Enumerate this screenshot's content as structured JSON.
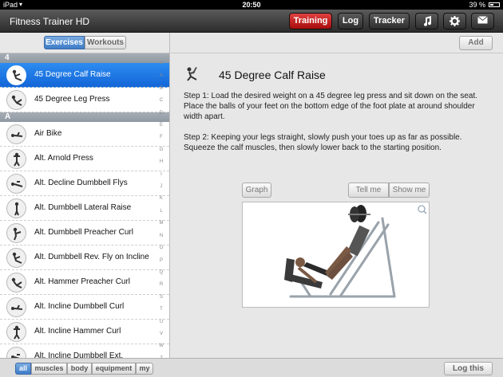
{
  "status": {
    "device": "iPad",
    "time": "20:50",
    "battery": "39 %"
  },
  "nav": {
    "app_title": "Fitness Trainer HD",
    "training": "Training",
    "log": "Log",
    "tracker": "Tracker",
    "music_icon": "music-note-icon",
    "settings_icon": "gear-icon",
    "mail_icon": "envelope-icon"
  },
  "left": {
    "tab_exercises": "Exercises",
    "tab_workouts": "Workouts",
    "section_4": "4",
    "section_a": "A",
    "index": [
      "4",
      "A",
      "B",
      "C",
      "D",
      "E",
      "F",
      "G",
      "H",
      "I",
      "J",
      "K",
      "L",
      "M",
      "N",
      "O",
      "P",
      "Q",
      "R",
      "S",
      "T",
      "U",
      "V",
      "W",
      "Z"
    ],
    "items": [
      "45 Degree Calf Raise",
      "45 Degree Leg Press",
      "Air Bike",
      "Alt. Arnold Press",
      "Alt. Decline Dumbbell Flys",
      "Alt. Dumbbell Lateral Raise",
      "Alt. Dumbbell Preacher Curl",
      "Alt. Dumbbell Rev. Fly on Incline",
      "Alt. Hammer Preacher Curl",
      "Alt. Incline Dumbbell Curl",
      "Alt. Incline Hammer Curl",
      "Alt. Incline Dumbbell Ext."
    ],
    "selected": 0
  },
  "right": {
    "add": "Add",
    "title": "45 Degree Calf Raise",
    "step1": "Step 1: Load the desired weight on a 45 degree leg press and sit down on the seat. Place the balls of your feet on the bottom edge of the foot plate at around shoulder width apart.",
    "step2": "Step 2: Keeping your legs straight, slowly push your toes up as far as possible. Squeeze the calf muscles, then slowly lower back to the starting position.",
    "graph": "Graph",
    "tell_me": "Tell me",
    "show_me": "Show me"
  },
  "bottom": {
    "filters": [
      "all",
      "muscles",
      "body",
      "equipment",
      "my"
    ],
    "selected_filter": "all",
    "log_this": "Log this"
  },
  "colors": {
    "accent": "#1a74e0",
    "training_red": "#c41d1d"
  }
}
